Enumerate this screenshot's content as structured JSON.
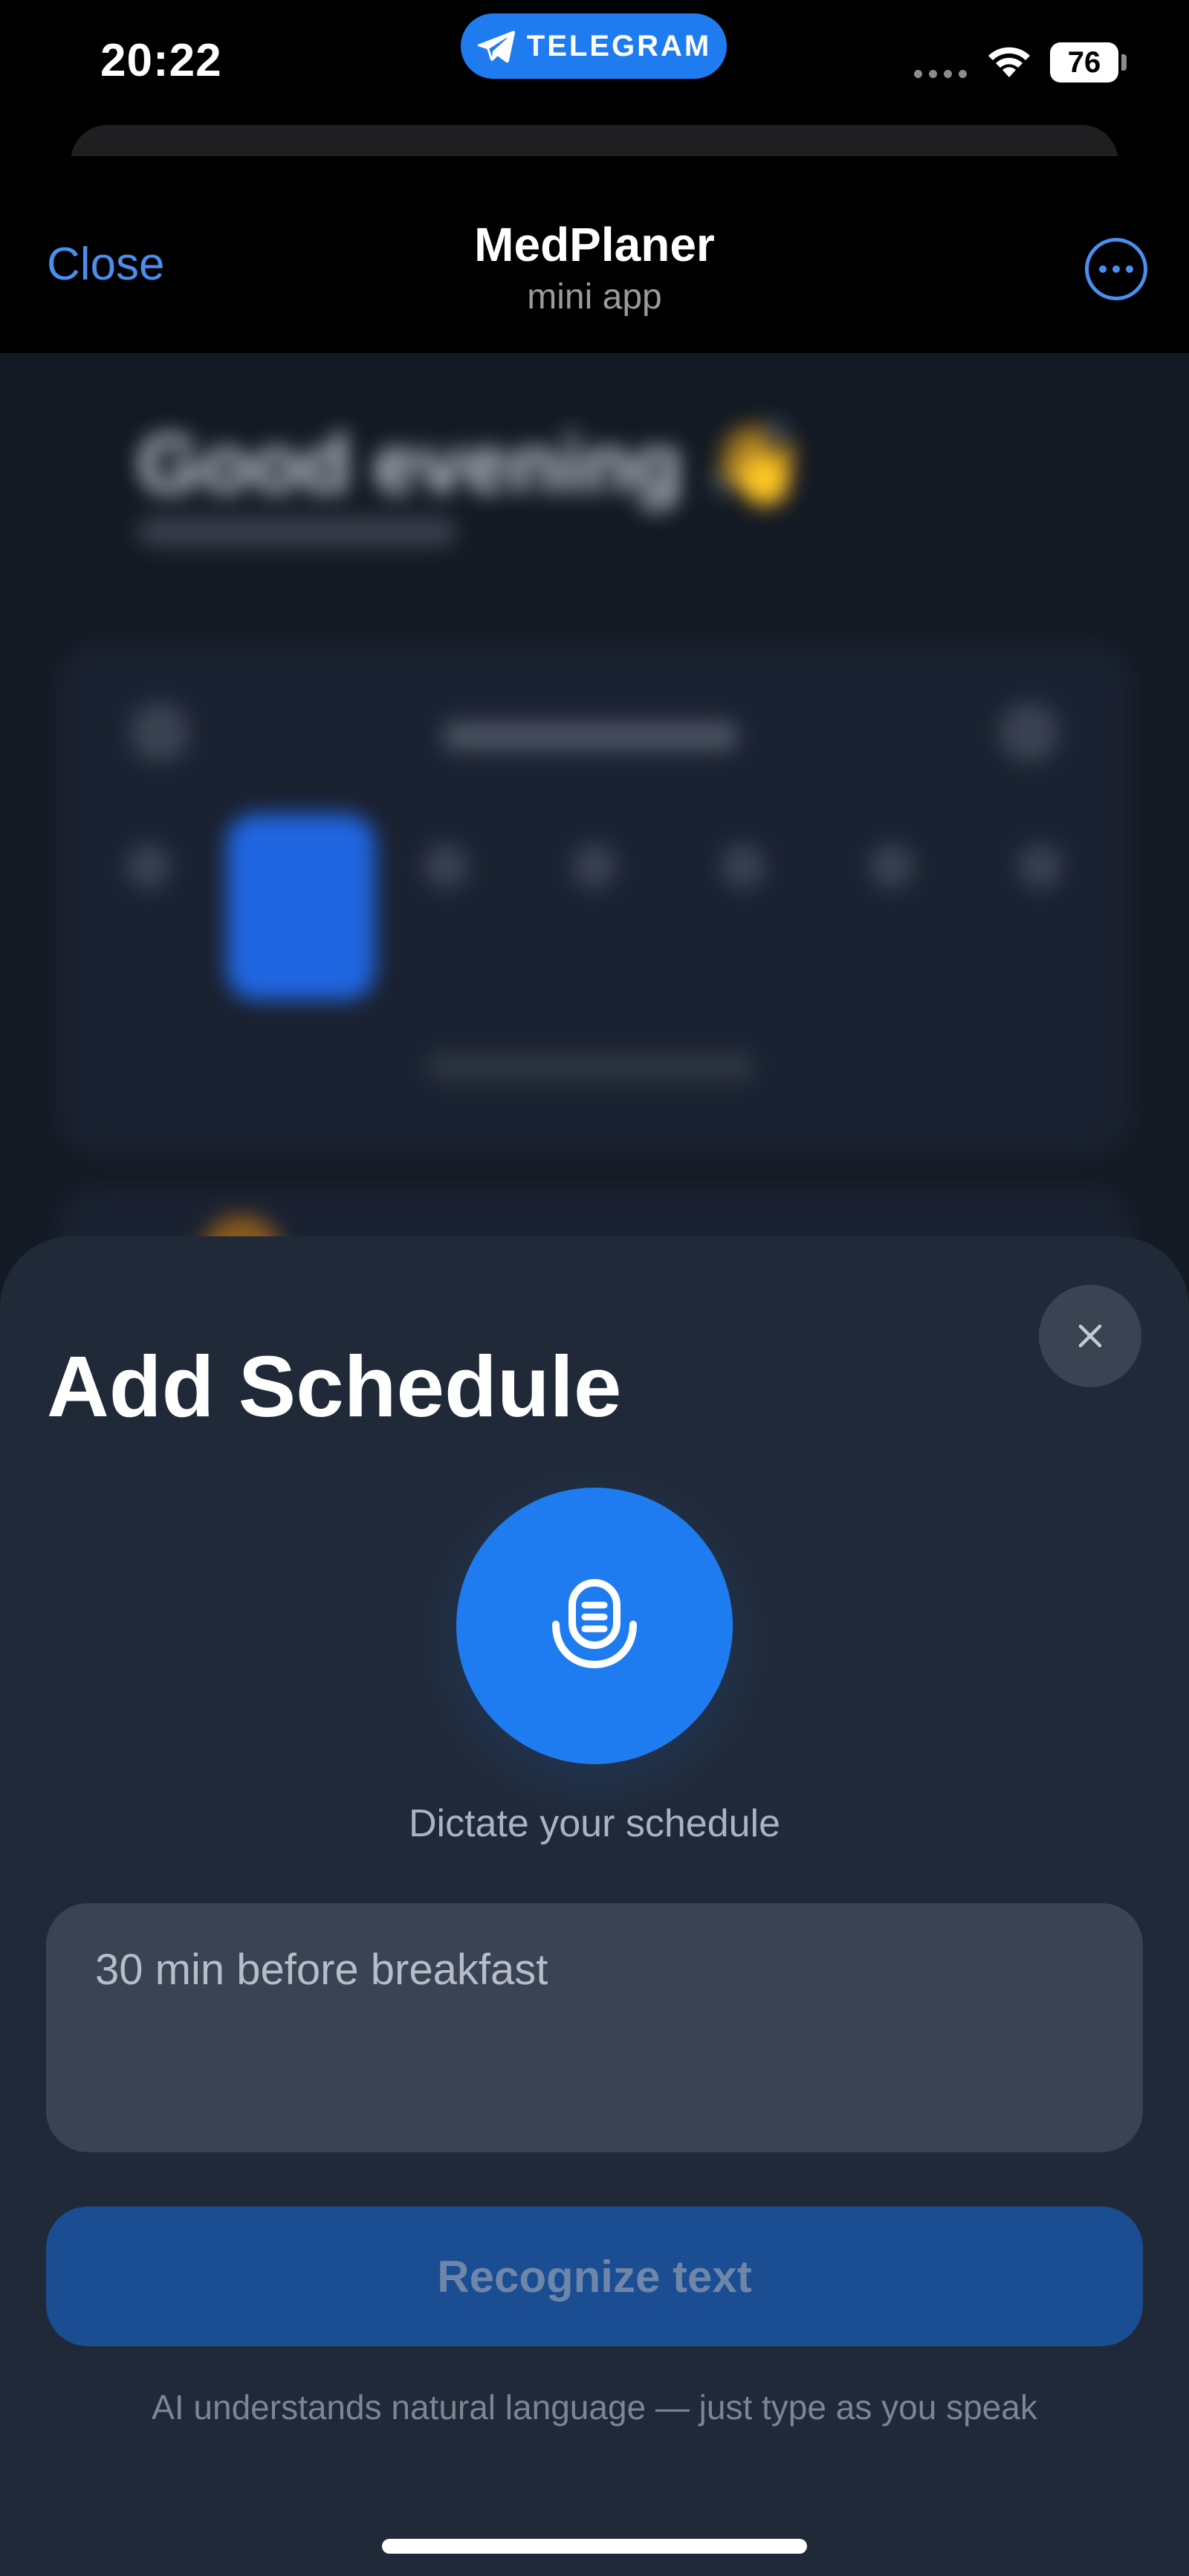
{
  "status_bar": {
    "time": "20:22",
    "pill_label": "TELEGRAM",
    "battery": "76"
  },
  "header": {
    "close_label": "Close",
    "title": "MedPlaner",
    "subtitle": "mini app"
  },
  "background_app": {
    "greeting": "Good evening 👋"
  },
  "sheet": {
    "title": "Add Schedule",
    "mic_caption": "Dictate your schedule",
    "input": {
      "value": "",
      "placeholder": "30 min before breakfast"
    },
    "recognize_label": "Recognize text",
    "hint": "AI understands natural language — just type as you speak"
  },
  "icons": {
    "pill": "telegram-logo-icon",
    "more": "more-dots-icon",
    "close": "close-icon",
    "mic": "microphone-icon"
  },
  "colors": {
    "accent": "#1f7cf0",
    "link": "#4a8eee",
    "sheet_bg": "#202938",
    "button_disabled": "#1a4d92"
  }
}
